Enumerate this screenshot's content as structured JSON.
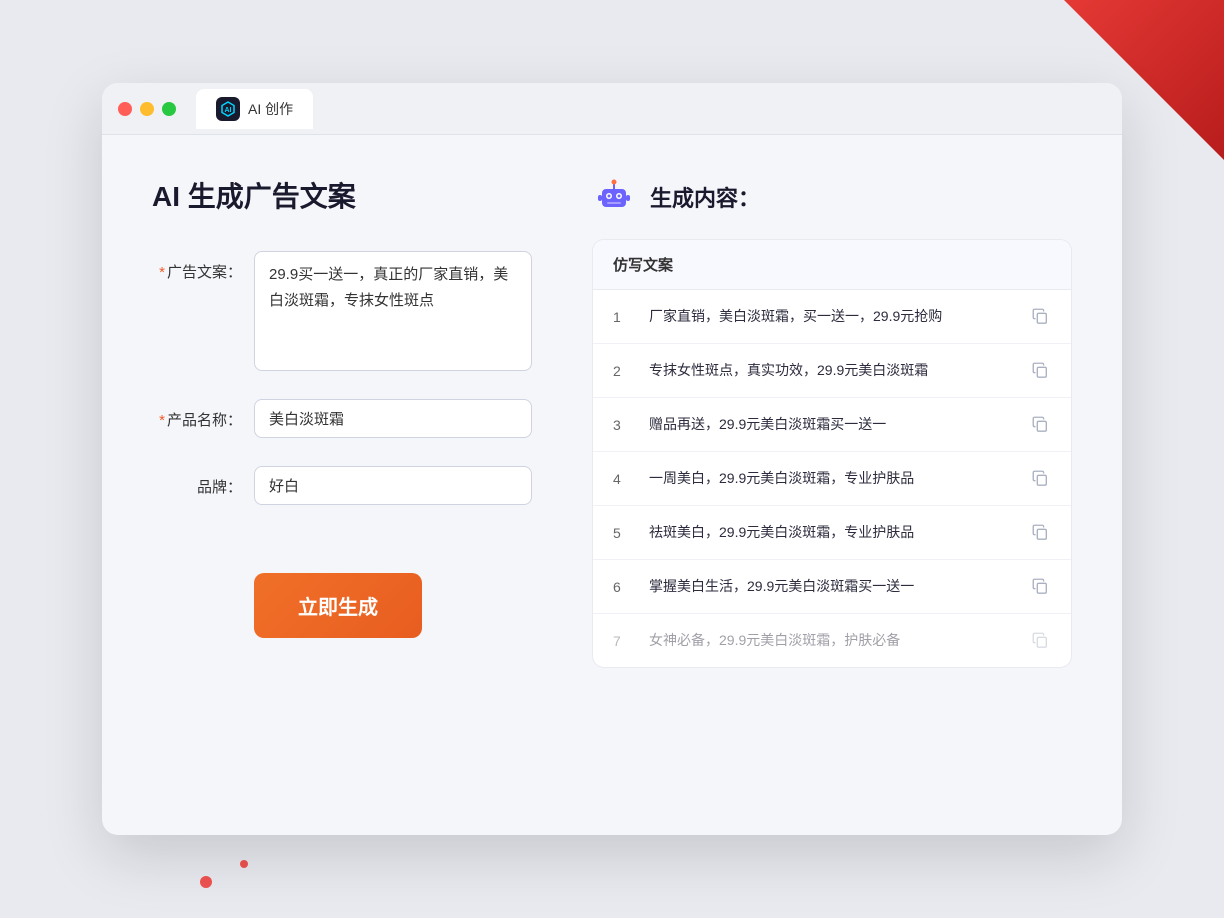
{
  "browser": {
    "tab_label": "AI 创作",
    "ai_icon_text": "AI"
  },
  "page": {
    "title": "AI 生成广告文案",
    "right_title": "生成内容："
  },
  "form": {
    "ad_copy_label": "广告文案：",
    "ad_copy_required": "*",
    "ad_copy_value": "29.9买一送一，真正的厂家直销，美白淡斑霜，专抹女性斑点",
    "product_name_label": "产品名称：",
    "product_name_required": "*",
    "product_name_value": "美白淡斑霜",
    "brand_label": "品牌：",
    "brand_value": "好白",
    "generate_btn": "立即生成"
  },
  "results": {
    "header": "仿写文案",
    "items": [
      {
        "num": "1",
        "text": "厂家直销，美白淡斑霜，买一送一，29.9元抢购",
        "dimmed": false
      },
      {
        "num": "2",
        "text": "专抹女性斑点，真实功效，29.9元美白淡斑霜",
        "dimmed": false
      },
      {
        "num": "3",
        "text": "赠品再送，29.9元美白淡斑霜买一送一",
        "dimmed": false
      },
      {
        "num": "4",
        "text": "一周美白，29.9元美白淡斑霜，专业护肤品",
        "dimmed": false
      },
      {
        "num": "5",
        "text": "祛斑美白，29.9元美白淡斑霜，专业护肤品",
        "dimmed": false
      },
      {
        "num": "6",
        "text": "掌握美白生活，29.9元美白淡斑霜买一送一",
        "dimmed": false
      },
      {
        "num": "7",
        "text": "女神必备，29.9元美白淡斑霜，护肤必备",
        "dimmed": true
      }
    ]
  }
}
